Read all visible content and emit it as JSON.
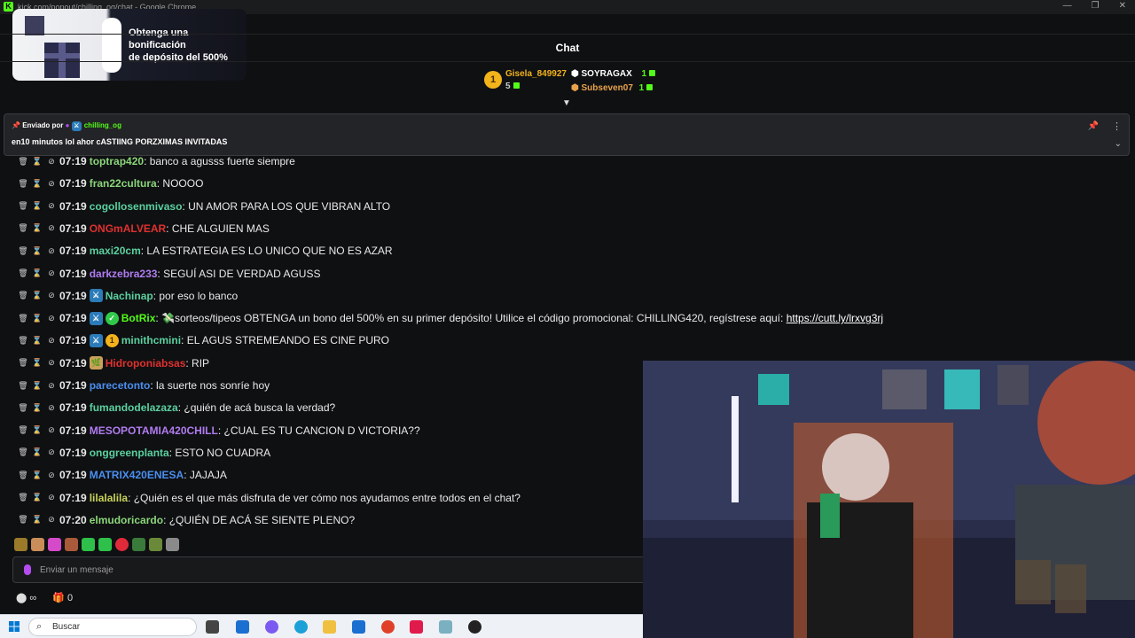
{
  "window": {
    "title": "kick.com/popout/chilling_og/chat - Google Chrome"
  },
  "ad": {
    "line1": "Obtenga una",
    "line2": "bonificación",
    "line3": "de depósito del 500%"
  },
  "chat_header": {
    "label": "Chat"
  },
  "leaderboard": {
    "rank": "1",
    "first_user": "Gisela_849927",
    "first_count": "5",
    "second_user": "SOYRAGAX",
    "second_count": "1",
    "third_user": "Subseven07",
    "third_count": "1"
  },
  "pinned": {
    "sent_by_label": "Enviado por",
    "user": "chilling_og",
    "message": "en10 minutos lol ahor cASTIING PORZXIMAS INVITADAS"
  },
  "messages": [
    {
      "time": "07:19",
      "user": "toptrap420",
      "text": ": banco a agusss fuerte siempre",
      "color": "#8bd67a"
    },
    {
      "time": "07:19",
      "user": "fran22cultura",
      "text": ": NOOOO",
      "color": "#8bd67a"
    },
    {
      "time": "07:19",
      "user": "cogollosenmivaso",
      "text": ": UN AMOR PARA LOS QUE VIBRAN ALTO",
      "color": "#5ad1a0"
    },
    {
      "time": "07:19",
      "user": "ONGmALVEAR",
      "text": ": CHE ALGUIEN MAS",
      "color": "#e0312f"
    },
    {
      "time": "07:19",
      "user": "maxi20cm",
      "text": ": LA ESTRATEGIA ES LO UNICO QUE NO ES AZAR",
      "color": "#5ad1a0"
    },
    {
      "time": "07:19",
      "user": "darkzebra233",
      "text": ": SEGUÍ ASI DE VERDAD AGUSS",
      "color": "#b07cf0"
    },
    {
      "time": "07:19",
      "user": "Nachinap",
      "text": ": por eso lo banco",
      "color": "#5ad1a0"
    },
    {
      "time": "07:19",
      "user": "BotRix",
      "text": ": 💸sorteos/tipeos OBTENGA un bono del 500% en su primer depósito! Utilice el código promocional: CHILLING420, regístrese aquí: ",
      "link": "https://cutt.ly/lrxvg3rj",
      "color": "#53fc18"
    },
    {
      "time": "07:19",
      "user": "minithcmini",
      "text": ": EL AGUS STREMEANDO ES CINE PURO",
      "color": "#5ad1a0"
    },
    {
      "time": "07:19",
      "user": "Hidroponiabsas",
      "text": ": RIP",
      "color": "#e0312f"
    },
    {
      "time": "07:19",
      "user": "parecetonto",
      "text": ": la suerte nos sonríe hoy",
      "color": "#4a8ff0"
    },
    {
      "time": "07:19",
      "user": "fumandodelazaza",
      "text": ": ¿quién de acá busca la verdad?",
      "color": "#5ad1a0"
    },
    {
      "time": "07:19",
      "user": "MESOPOTAMIA420CHILL",
      "text": ": ¿CUAL ES TU CANCION D VICTORIA??",
      "color": "#b07cf0"
    },
    {
      "time": "07:19",
      "user": "onggreenplanta",
      "text": ": ESTO NO CUADRA",
      "color": "#5ad1a0"
    },
    {
      "time": "07:19",
      "user": "MATRIX420ENESA",
      "text": ": JAJAJA",
      "color": "#4a8ff0"
    },
    {
      "time": "07:19",
      "user": "lilalalila",
      "text": ": ¿Quién es el que más disfruta de ver cómo nos ayudamos entre todos en el chat?",
      "color": "#c9d35a"
    },
    {
      "time": "07:20",
      "user": "elmudoricardo",
      "text": ": ¿QUIÉN DE ACÁ SE SIENTE PLENO?",
      "color": "#8bd67a"
    }
  ],
  "input": {
    "placeholder": "Enviar un mensaje"
  },
  "bottom": {
    "points": "∞",
    "count": "0"
  },
  "taskbar": {
    "search_label": "Buscar"
  }
}
